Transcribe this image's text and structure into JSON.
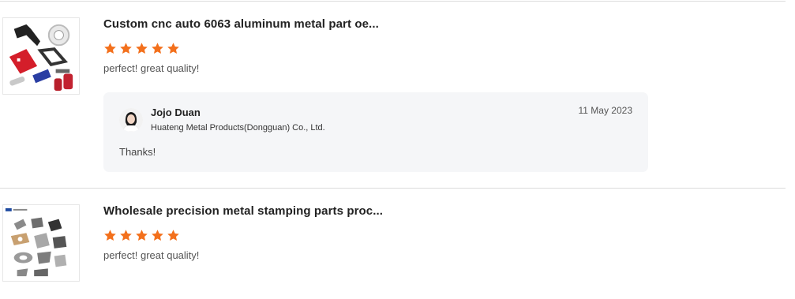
{
  "reviews": [
    {
      "product_title": "Custom cnc auto 6063 aluminum metal part oe...",
      "rating": 5,
      "comment": "perfect! great quality!",
      "reply": {
        "name": "Jojo Duan",
        "company": "Huateng Metal Products(Dongguan) Co., Ltd.",
        "date": "11 May 2023",
        "text": "Thanks!"
      }
    },
    {
      "product_title": "Wholesale precision metal stamping parts proc...",
      "rating": 5,
      "comment": "perfect! great quality!"
    }
  ],
  "colors": {
    "star": "#f3701c",
    "reply_background": "#f5f6f8",
    "divider": "#dcdcdc"
  },
  "icons": {
    "star": "star-icon"
  }
}
